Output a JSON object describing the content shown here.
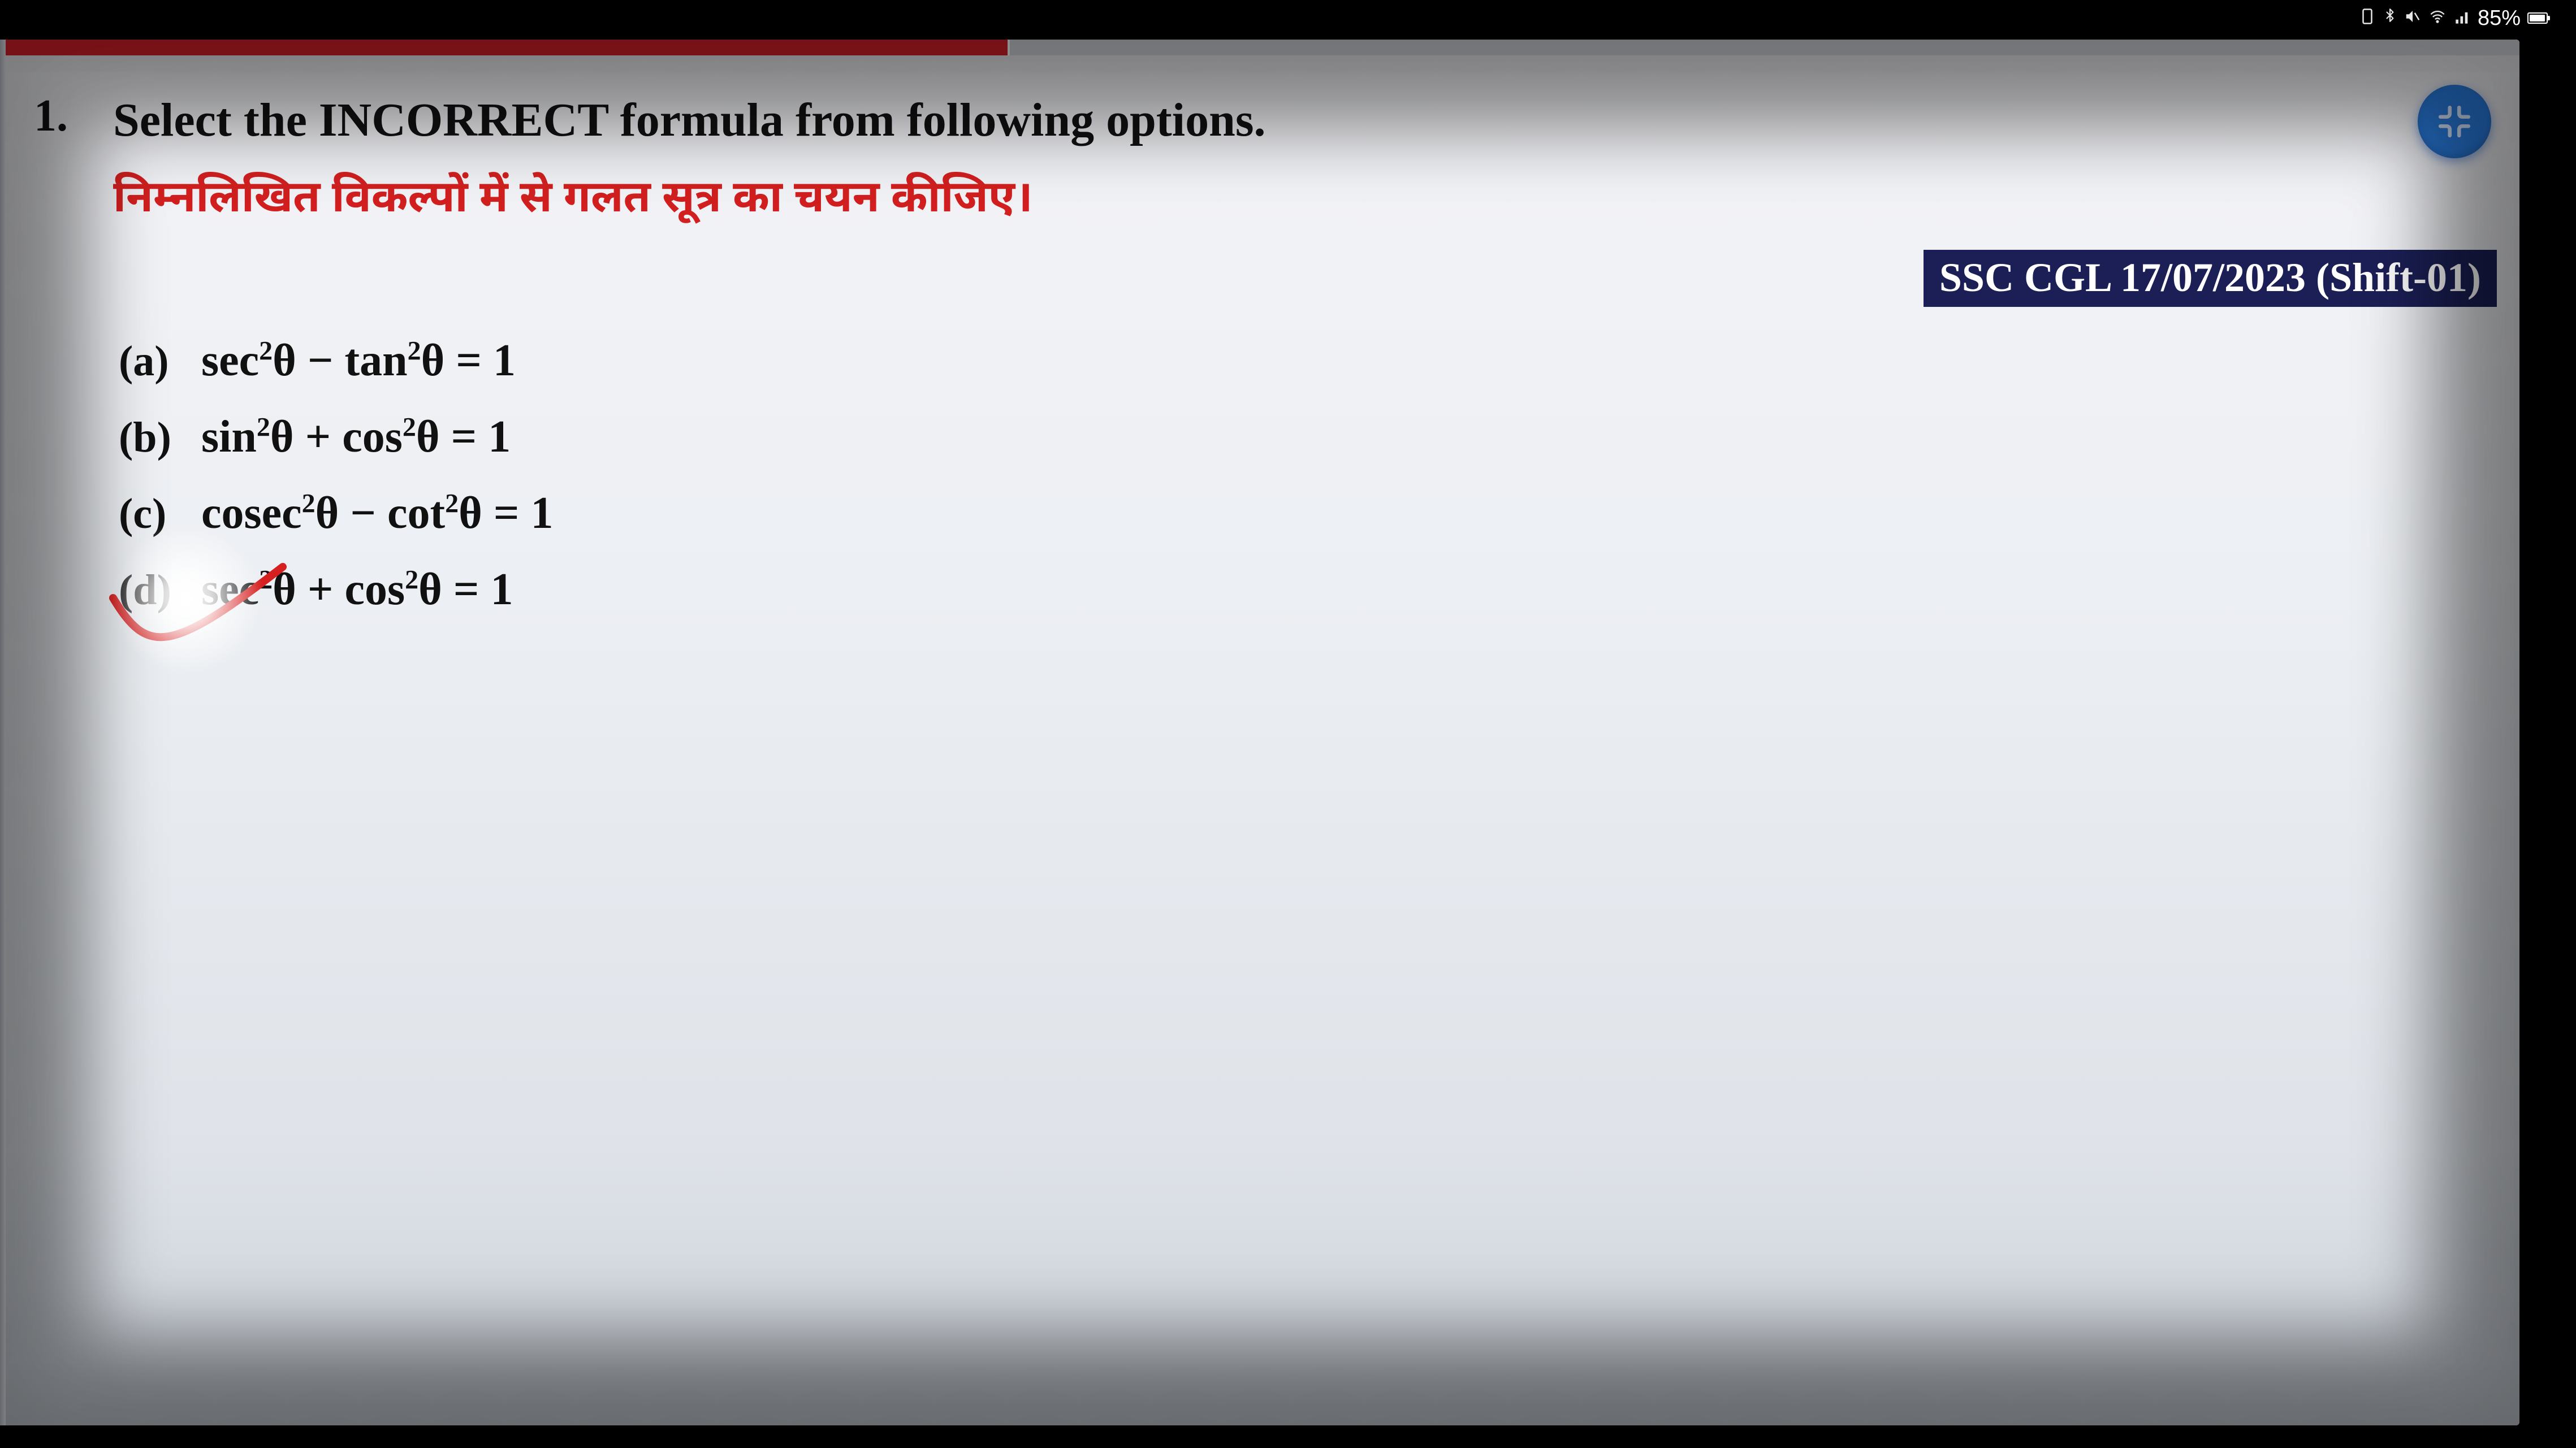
{
  "status": {
    "battery_pct": "85%"
  },
  "question": {
    "number": "1.",
    "title_en": "Select the INCORRECT formula from following options.",
    "title_hi": "निम्नलिखित विकल्पों में से गलत सूत्र का चयन कीजिए।",
    "exam_tag": "SSC CGL 17/07/2023 (Shift-01)",
    "options": [
      {
        "label": "(a)",
        "lhs1": "sec",
        "op": "−",
        "lhs2": "tan",
        "rhs": "= 1"
      },
      {
        "label": "(b)",
        "lhs1": "sin",
        "op": "+",
        "lhs2": "cos",
        "rhs": "= 1"
      },
      {
        "label": "(c)",
        "lhs1": "cosec",
        "op": "−",
        "lhs2": "cot",
        "rhs": "= 1"
      },
      {
        "label": "(d)",
        "lhs1": "sec",
        "op": "+",
        "lhs2": "cos",
        "rhs": "= 1"
      }
    ],
    "answer_index": 3
  }
}
